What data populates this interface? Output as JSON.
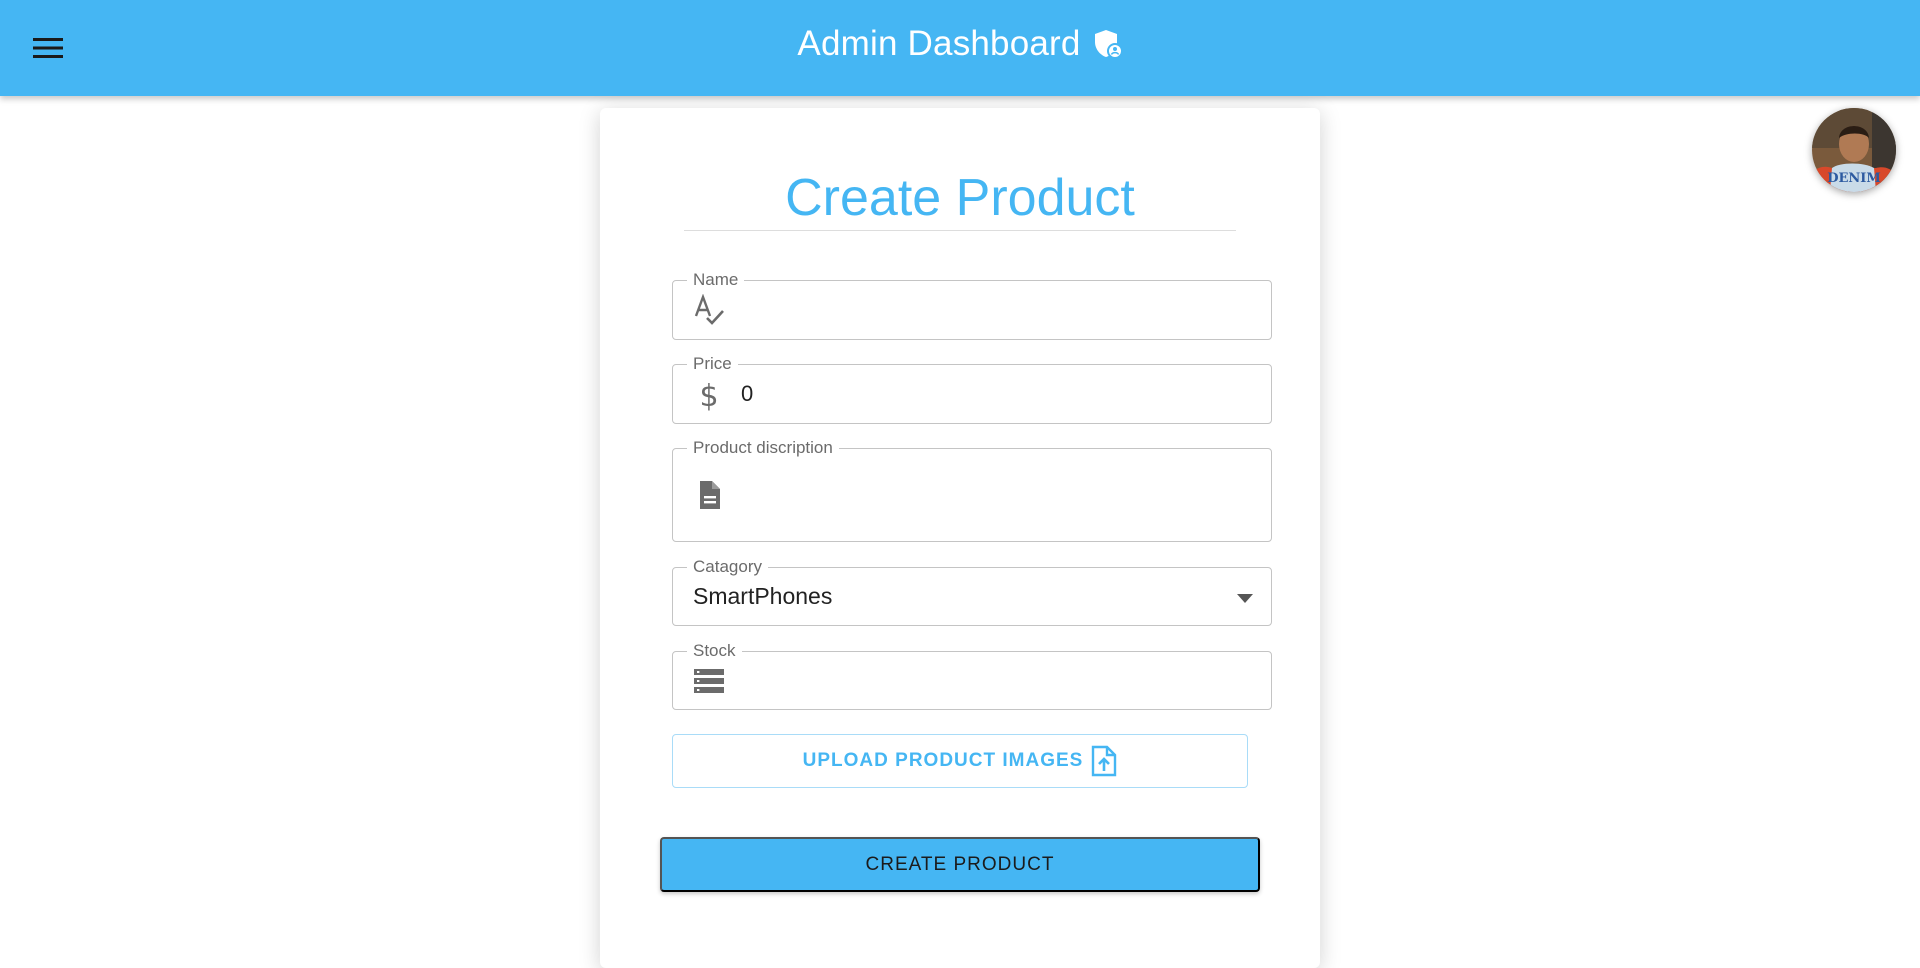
{
  "appbar": {
    "title": "Admin Dashboard",
    "menu_icon": "menu-icon",
    "title_icon": "admin-shield-icon",
    "color": "#45b6f3"
  },
  "avatar": {
    "icon": "user-avatar"
  },
  "form": {
    "title": "Create Product",
    "fields": {
      "name": {
        "label": "Name",
        "value": "",
        "icon": "spellcheck-icon"
      },
      "price": {
        "label": "Price",
        "value": "0",
        "icon": "dollar-icon"
      },
      "description": {
        "label": "Product discription",
        "value": "",
        "icon": "description-icon"
      },
      "category": {
        "label": "Catagory",
        "value": "SmartPhones",
        "icon": "dropdown-arrow-icon"
      },
      "stock": {
        "label": "Stock",
        "value": "",
        "icon": "storage-icon"
      }
    },
    "upload_label": "UPLOAD PRODUCT IMAGES",
    "upload_icon": "upload-file-icon",
    "submit_label": "CREATE PRODUCT"
  },
  "colors": {
    "accent": "#45b6f3",
    "border": "#c4c4c4",
    "label": "#6b6b6b"
  }
}
